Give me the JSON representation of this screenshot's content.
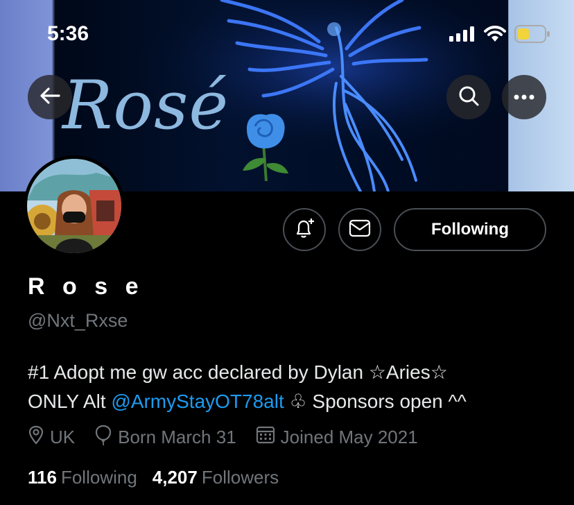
{
  "status_bar": {
    "time": "5:36"
  },
  "banner": {
    "word": "Rosé"
  },
  "profile": {
    "display_name": "R o s e",
    "handle": "@Nxt_Rxse",
    "follow_label": "Following",
    "bio_line1": "#1 Adopt me gw acc declared by Dylan ☆Aries☆",
    "bio_line2_prefix": "ONLY Alt ",
    "bio_mention": "@ArmyStayOT78alt",
    "bio_line2_suffix": " ♧ Sponsors open ^^",
    "location": "UK",
    "birthday": "Born March 31",
    "joined": "Joined May 2021",
    "following_count": "116",
    "following_label": "Following",
    "followers_count": "4,207",
    "followers_label": "Followers"
  },
  "icons": {
    "back": "arrow-left-icon",
    "search": "search-icon",
    "more": "more-icon",
    "notify": "bell-plus-icon",
    "message": "envelope-icon",
    "location": "map-pin-icon",
    "birthday": "balloon-icon",
    "calendar": "calendar-icon"
  },
  "colors": {
    "accent": "#1d9bf0",
    "muted": "#71767b",
    "background": "#000000",
    "battery": "#f2d43a"
  }
}
